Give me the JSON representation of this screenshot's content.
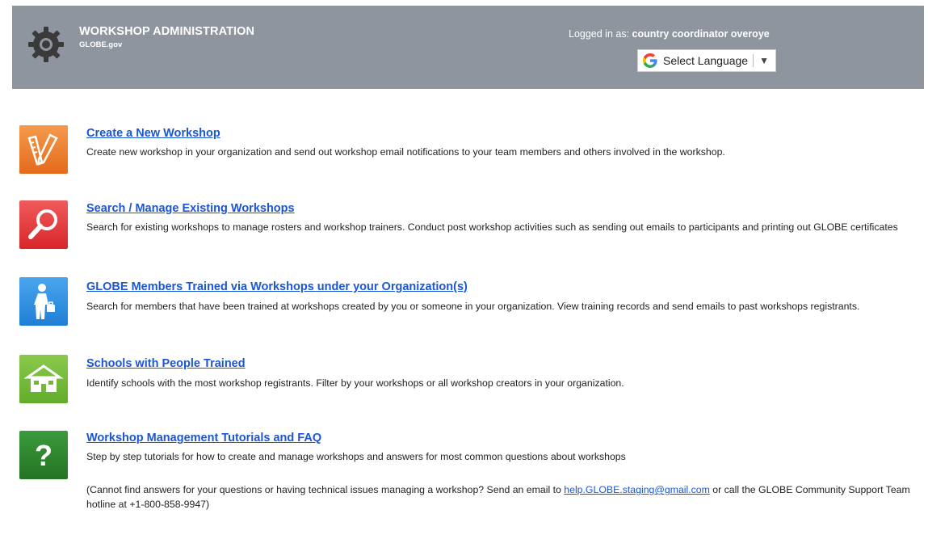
{
  "header": {
    "title": "WORKSHOP ADMINISTRATION",
    "subtitle": "GLOBE.gov",
    "logged_in_label": "Logged in as:",
    "logged_in_user": "country coordinator overoye",
    "language_select": "Select Language",
    "language_arrow": "▼"
  },
  "colors": {
    "header_bg": "#8f959e",
    "link": "#1a56d6",
    "tile_create": "#ef7d2a",
    "tile_search": "#e8383c",
    "tile_members": "#2b8ddf",
    "tile_schools": "#71b839",
    "tile_tutorials": "#2f8a2f"
  },
  "items": [
    {
      "icon": "pencil-ruler-icon",
      "title": "Create a New Workshop",
      "description": "Create new workshop in your organization and send out workshop email notifications to your team members and others involved in the workshop."
    },
    {
      "icon": "magnifier-icon",
      "title": "Search / Manage Existing Workshops",
      "description": "Search for existing workshops to manage rosters and workshop trainers. Conduct post workshop activities such as sending out emails to participants and printing out GLOBE certificates"
    },
    {
      "icon": "person-briefcase-icon",
      "title": "GLOBE Members Trained via Workshops under your Organization(s)",
      "description": "Search for members that have been trained at workshops created by you or someone in your organization. View training records and send emails to past workshops registrants."
    },
    {
      "icon": "school-building-icon",
      "title": "Schools with People Trained",
      "description": "Identify schools with the most workshop registrants. Filter by your workshops or all workshop creators in your organization."
    },
    {
      "icon": "question-mark-icon",
      "title": "Workshop Management Tutorials and FAQ",
      "description": "Step by step tutorials for how to create and manage workshops and answers for most common questions about workshops",
      "help_prefix": "(Cannot find answers for your questions or having technical issues managing a workshop? Send an email to ",
      "help_email": "help.GLOBE.staging@gmail.com",
      "help_suffix": " or call the GLOBE Community Support Team hotline at +1-800-858-9947)"
    }
  ]
}
